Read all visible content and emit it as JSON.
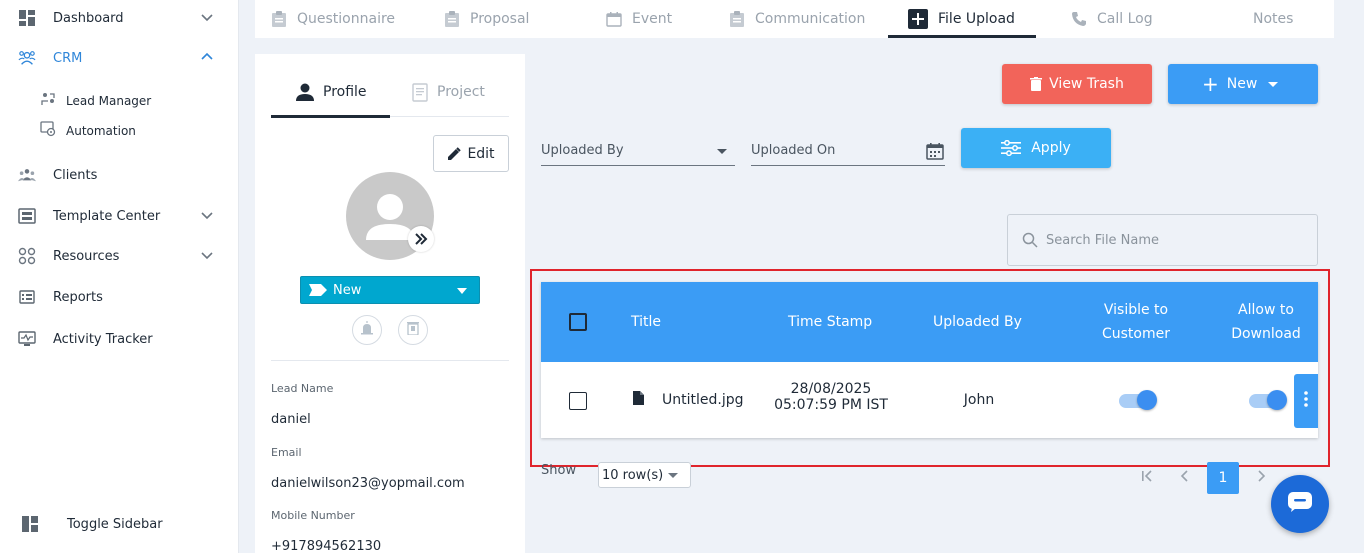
{
  "sidebar": {
    "items": [
      {
        "label": "Dashboard",
        "icon": "dashboard-icon"
      },
      {
        "label": "CRM",
        "icon": "crm-icon"
      },
      {
        "label": "Clients",
        "icon": "clients-icon"
      },
      {
        "label": "Template Center",
        "icon": "template-icon"
      },
      {
        "label": "Resources",
        "icon": "resources-icon"
      },
      {
        "label": "Reports",
        "icon": "reports-icon"
      },
      {
        "label": "Activity Tracker",
        "icon": "activity-icon"
      }
    ],
    "crm_sub": [
      {
        "label": "Lead Manager"
      },
      {
        "label": "Automation"
      }
    ],
    "toggle_label": "Toggle Sidebar",
    "accent_color": "#2f86d9"
  },
  "top_tabs": [
    {
      "label": "Questionnaire"
    },
    {
      "label": "Proposal"
    },
    {
      "label": "Event"
    },
    {
      "label": "Communication"
    },
    {
      "label": "File Upload"
    },
    {
      "label": "Call Log"
    },
    {
      "label": "Notes"
    }
  ],
  "profile": {
    "tab_profile": "Profile",
    "tab_project": "Project",
    "edit_label": "Edit",
    "status": "New",
    "status_color": "#00a7cf",
    "fields": [
      {
        "label": "Lead Name",
        "value": "daniel"
      },
      {
        "label": "Email",
        "value": "danielwilson23@yopmail.com"
      },
      {
        "label": "Mobile Number",
        "value": "+917894562130"
      }
    ]
  },
  "actions": {
    "view_trash": "View Trash",
    "new": "New",
    "apply": "Apply",
    "trash_color": "#f2645a",
    "primary_color": "#3b9cf5"
  },
  "filters": {
    "uploaded_by": "Uploaded By",
    "uploaded_on": "Uploaded On"
  },
  "search": {
    "placeholder": "Search File Name"
  },
  "table": {
    "headers": {
      "title": "Title",
      "time_stamp": "Time Stamp",
      "uploaded_by": "Uploaded By",
      "visible_1": "Visible to",
      "visible_2": "Customer",
      "download_1": "Allow to",
      "download_2": "Download"
    },
    "rows": [
      {
        "title": "Untitled.jpg",
        "date": "28/08/2025",
        "time": "05:07:59 PM IST",
        "uploaded_by": "John",
        "visible_to_customer": true,
        "allow_download": true
      }
    ]
  },
  "pagination": {
    "show_label": "Show",
    "rows_option": "10 row(s)",
    "current_page": "1"
  }
}
